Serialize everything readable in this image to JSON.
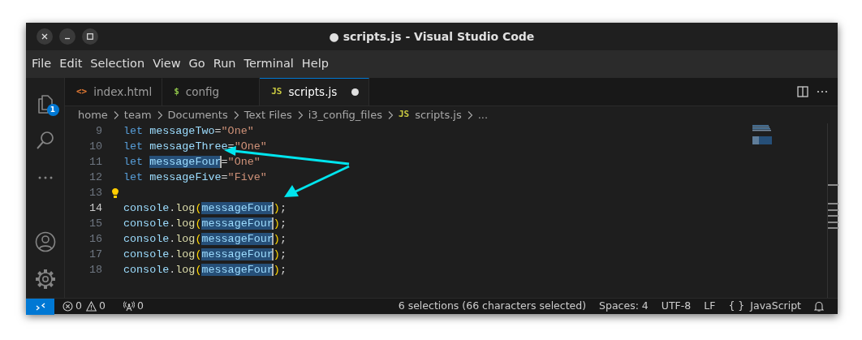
{
  "window": {
    "title": "● scripts.js - Visual Studio Code"
  },
  "menu": [
    "File",
    "Edit",
    "Selection",
    "View",
    "Go",
    "Run",
    "Terminal",
    "Help"
  ],
  "activity_bar": {
    "explorer_badge": "1"
  },
  "tabs": [
    {
      "icon": "<>",
      "color": "#e37933",
      "label": "index.html",
      "selected": false,
      "dirty": false
    },
    {
      "icon": "$",
      "color": "#8dc149",
      "label": "config",
      "selected": false,
      "dirty": false
    },
    {
      "icon": "JS",
      "color": "#cbcb41",
      "label": "scripts.js",
      "selected": true,
      "dirty": true
    }
  ],
  "breadcrumb": [
    {
      "label": "home"
    },
    {
      "label": "team"
    },
    {
      "label": "Documents"
    },
    {
      "label": "Text Files"
    },
    {
      "label": "i3_config_files"
    },
    {
      "icon": "JS",
      "color": "#cbcb41",
      "label": "scripts.js"
    },
    {
      "label": "..."
    }
  ],
  "lines": [
    {
      "number": "9",
      "active": false,
      "lightbulb": false,
      "tokens": [
        {
          "text": "let ",
          "kind": "keyword",
          "selected": false,
          "cursor": false
        },
        {
          "text": "messageTwo",
          "kind": "variable",
          "selected": false,
          "cursor": false
        },
        {
          "text": "=",
          "kind": "operator",
          "selected": false,
          "cursor": false
        },
        {
          "text": "\"One\"",
          "kind": "string",
          "selected": false,
          "cursor": false
        }
      ]
    },
    {
      "number": "10",
      "active": false,
      "lightbulb": false,
      "tokens": [
        {
          "text": "let ",
          "kind": "keyword",
          "selected": false,
          "cursor": false
        },
        {
          "text": "messageThree",
          "kind": "variable",
          "selected": false,
          "cursor": false
        },
        {
          "text": "=",
          "kind": "operator",
          "selected": false,
          "cursor": false
        },
        {
          "text": "\"One\"",
          "kind": "string",
          "selected": false,
          "cursor": false
        }
      ]
    },
    {
      "number": "11",
      "active": false,
      "lightbulb": false,
      "tokens": [
        {
          "text": "let ",
          "kind": "keyword",
          "selected": false,
          "cursor": false
        },
        {
          "text": "messageFour",
          "kind": "variable",
          "selected": true,
          "cursor": true
        },
        {
          "text": "=",
          "kind": "operator",
          "selected": false,
          "cursor": false
        },
        {
          "text": "\"One\"",
          "kind": "string",
          "selected": false,
          "cursor": false
        }
      ]
    },
    {
      "number": "12",
      "active": false,
      "lightbulb": false,
      "tokens": [
        {
          "text": "let ",
          "kind": "keyword",
          "selected": false,
          "cursor": false
        },
        {
          "text": "messageFive",
          "kind": "variable",
          "selected": false,
          "cursor": false
        },
        {
          "text": "=",
          "kind": "operator",
          "selected": false,
          "cursor": false
        },
        {
          "text": "\"Five\"",
          "kind": "string",
          "selected": false,
          "cursor": false
        }
      ]
    },
    {
      "number": "13",
      "active": false,
      "lightbulb": true
    },
    {
      "number": "14",
      "active": true,
      "lightbulb": false,
      "tokens": [
        {
          "text": "console",
          "kind": "variable",
          "selected": false,
          "cursor": false
        },
        {
          "text": ".",
          "kind": "punct",
          "selected": false,
          "cursor": false
        },
        {
          "text": "log",
          "kind": "function",
          "selected": false,
          "cursor": false
        },
        {
          "text": "(",
          "kind": "bracket",
          "selected": false,
          "cursor": false
        },
        {
          "text": "messageFour",
          "kind": "variable",
          "selected": true,
          "cursor": true
        },
        {
          "text": ")",
          "kind": "bracket",
          "selected": false,
          "cursor": false
        },
        {
          "text": ";",
          "kind": "punct",
          "selected": false,
          "cursor": false
        }
      ]
    },
    {
      "number": "15",
      "active": false,
      "lightbulb": false,
      "tokens": [
        {
          "text": "console",
          "kind": "variable",
          "selected": false,
          "cursor": false
        },
        {
          "text": ".",
          "kind": "punct",
          "selected": false,
          "cursor": false
        },
        {
          "text": "log",
          "kind": "function",
          "selected": false,
          "cursor": false
        },
        {
          "text": "(",
          "kind": "bracket",
          "selected": false,
          "cursor": false
        },
        {
          "text": "messageFour",
          "kind": "variable",
          "selected": true,
          "cursor": true
        },
        {
          "text": ")",
          "kind": "bracket",
          "selected": false,
          "cursor": false
        },
        {
          "text": ";",
          "kind": "punct",
          "selected": false,
          "cursor": false
        }
      ]
    },
    {
      "number": "16",
      "active": false,
      "lightbulb": false,
      "tokens": [
        {
          "text": "console",
          "kind": "variable",
          "selected": false,
          "cursor": false
        },
        {
          "text": ".",
          "kind": "punct",
          "selected": false,
          "cursor": false
        },
        {
          "text": "log",
          "kind": "function",
          "selected": false,
          "cursor": false
        },
        {
          "text": "(",
          "kind": "bracket",
          "selected": false,
          "cursor": false
        },
        {
          "text": "messageFour",
          "kind": "variable",
          "selected": true,
          "cursor": true
        },
        {
          "text": ")",
          "kind": "bracket",
          "selected": false,
          "cursor": false
        },
        {
          "text": ";",
          "kind": "punct",
          "selected": false,
          "cursor": false
        }
      ]
    },
    {
      "number": "17",
      "active": false,
      "lightbulb": false,
      "tokens": [
        {
          "text": "console",
          "kind": "variable",
          "selected": false,
          "cursor": false
        },
        {
          "text": ".",
          "kind": "punct",
          "selected": false,
          "cursor": false
        },
        {
          "text": "log",
          "kind": "function",
          "selected": false,
          "cursor": false
        },
        {
          "text": "(",
          "kind": "bracket",
          "selected": false,
          "cursor": false
        },
        {
          "text": "messageFour",
          "kind": "variable",
          "selected": true,
          "cursor": true
        },
        {
          "text": ")",
          "kind": "bracket",
          "selected": false,
          "cursor": false
        },
        {
          "text": ";",
          "kind": "punct",
          "selected": false,
          "cursor": false
        }
      ]
    },
    {
      "number": "18",
      "active": false,
      "lightbulb": false,
      "tokens": [
        {
          "text": "console",
          "kind": "variable",
          "selected": false,
          "cursor": false
        },
        {
          "text": ".",
          "kind": "punct",
          "selected": false,
          "cursor": false
        },
        {
          "text": "log",
          "kind": "function",
          "selected": false,
          "cursor": false
        },
        {
          "text": "(",
          "kind": "bracket",
          "selected": false,
          "cursor": false
        },
        {
          "text": "messageFour",
          "kind": "variable",
          "selected": true,
          "cursor": true
        },
        {
          "text": ")",
          "kind": "bracket",
          "selected": false,
          "cursor": false
        },
        {
          "text": ";",
          "kind": "punct",
          "selected": false,
          "cursor": false
        }
      ]
    }
  ],
  "status_bar": {
    "errors": "0",
    "warnings": "0",
    "ports": "0",
    "selection": "6 selections (66 characters selected)",
    "indent": "Spaces: 4",
    "encoding": "UTF-8",
    "eol": "LF",
    "language_icon": "{ }",
    "language": "JavaScript"
  }
}
